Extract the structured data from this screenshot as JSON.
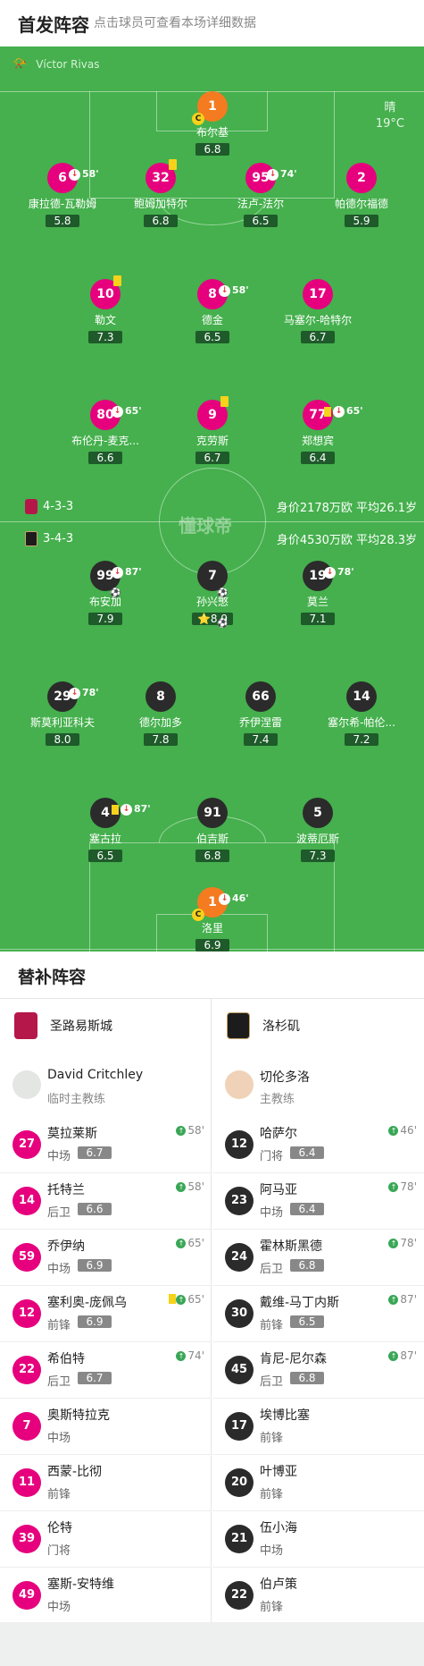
{
  "header": {
    "title": "首发阵容",
    "subtitle": "点击球员可查看本场详细数据"
  },
  "pitch": {
    "referee": "Víctor Rivas",
    "weather": {
      "condition": "晴",
      "temp": "19°C"
    },
    "watermark": "懂球帝",
    "home_bar": {
      "formation": "4-3-3",
      "value": "身价2178万欧 平均26.1岁"
    },
    "away_bar": {
      "formation": "3-4-3",
      "value": "身价4530万欧 平均28.3岁"
    }
  },
  "home_players": [
    {
      "num": "1",
      "name": "布尔基",
      "rating": "6.8",
      "captain": "C",
      "gk": true
    },
    {
      "num": "6",
      "name": "康拉德-瓦勒姆",
      "rating": "5.8",
      "sub": "58'"
    },
    {
      "num": "32",
      "name": "鲍姆加特尔",
      "rating": "6.8",
      "yellow": true
    },
    {
      "num": "95",
      "name": "法卢-法尔",
      "rating": "6.5",
      "sub": "74'"
    },
    {
      "num": "2",
      "name": "帕德尔福德",
      "rating": "5.9"
    },
    {
      "num": "10",
      "name": "勒文",
      "rating": "7.3",
      "yellow": true
    },
    {
      "num": "8",
      "name": "德金",
      "rating": "6.5",
      "sub": "58'"
    },
    {
      "num": "17",
      "name": "马塞尔-哈特尔",
      "rating": "6.7"
    },
    {
      "num": "80",
      "name": "布伦丹-麦克...",
      "rating": "6.6",
      "sub": "65'"
    },
    {
      "num": "9",
      "name": "克劳斯",
      "rating": "6.7",
      "yellow": true
    },
    {
      "num": "77",
      "name": "郑想宾",
      "rating": "6.4",
      "sub": "65'",
      "yellow": true
    }
  ],
  "away_players": [
    {
      "num": "99",
      "name": "布安加",
      "rating": "7.9",
      "sub": "87'",
      "goals": "⚽"
    },
    {
      "num": "7",
      "name": "孙兴慜",
      "rating": "8.9",
      "goals": "⚽⚽",
      "star": "⭐"
    },
    {
      "num": "19",
      "name": "莫兰",
      "rating": "7.1",
      "sub": "78'"
    },
    {
      "num": "29",
      "name": "斯莫利亚科夫",
      "rating": "8.0",
      "sub": "78'"
    },
    {
      "num": "8",
      "name": "德尔加多",
      "rating": "7.8"
    },
    {
      "num": "66",
      "name": "乔伊涅雷",
      "rating": "7.4"
    },
    {
      "num": "14",
      "name": "塞尔希-帕伦...",
      "rating": "7.2"
    },
    {
      "num": "4",
      "name": "塞古拉",
      "rating": "6.5",
      "sub": "87'",
      "yellow": true
    },
    {
      "num": "91",
      "name": "伯吉斯",
      "rating": "6.8"
    },
    {
      "num": "5",
      "name": "波蒂厄斯",
      "rating": "7.3"
    },
    {
      "num": "1",
      "name": "洛里",
      "rating": "6.9",
      "sub": "46'",
      "captain": "C",
      "gk": true
    }
  ],
  "subs": {
    "title": "替补阵容",
    "home": {
      "team": "圣路易斯城",
      "coach": {
        "name": "David Critchley",
        "role": "临时主教练"
      },
      "players": [
        {
          "num": "27",
          "name": "莫拉莱斯",
          "pos": "中场",
          "rating": "6.7",
          "time": "58'"
        },
        {
          "num": "14",
          "name": "托特兰",
          "pos": "后卫",
          "rating": "6.6",
          "time": "58'"
        },
        {
          "num": "59",
          "name": "乔伊纳",
          "pos": "中场",
          "rating": "6.9",
          "time": "65'"
        },
        {
          "num": "12",
          "name": "塞利奥-庞佩乌",
          "pos": "前锋",
          "rating": "6.9",
          "time": "65'",
          "yellow": true
        },
        {
          "num": "22",
          "name": "希伯特",
          "pos": "后卫",
          "rating": "6.7",
          "time": "74'"
        },
        {
          "num": "7",
          "name": "奥斯特拉克",
          "pos": "中场"
        },
        {
          "num": "11",
          "name": "西蒙-比彻",
          "pos": "前锋"
        },
        {
          "num": "39",
          "name": "伦特",
          "pos": "门将"
        },
        {
          "num": "49",
          "name": "塞斯-安特维",
          "pos": "中场"
        }
      ]
    },
    "away": {
      "team": "洛杉矶",
      "coach": {
        "name": "切伦多洛",
        "role": "主教练"
      },
      "players": [
        {
          "num": "12",
          "name": "哈萨尔",
          "pos": "门将",
          "rating": "6.4",
          "time": "46'"
        },
        {
          "num": "23",
          "name": "阿马亚",
          "pos": "中场",
          "rating": "6.4",
          "time": "78'"
        },
        {
          "num": "24",
          "name": "霍林斯黑德",
          "pos": "后卫",
          "rating": "6.8",
          "time": "78'"
        },
        {
          "num": "30",
          "name": "戴维-马丁内斯",
          "pos": "前锋",
          "rating": "6.5",
          "time": "87'"
        },
        {
          "num": "45",
          "name": "肯尼-尼尔森",
          "pos": "后卫",
          "rating": "6.8",
          "time": "87'"
        },
        {
          "num": "17",
          "name": "埃博比塞",
          "pos": "前锋"
        },
        {
          "num": "20",
          "name": "叶博亚",
          "pos": "前锋"
        },
        {
          "num": "21",
          "name": "伍小海",
          "pos": "中场"
        },
        {
          "num": "22",
          "name": "伯卢策",
          "pos": "前锋"
        }
      ]
    }
  }
}
